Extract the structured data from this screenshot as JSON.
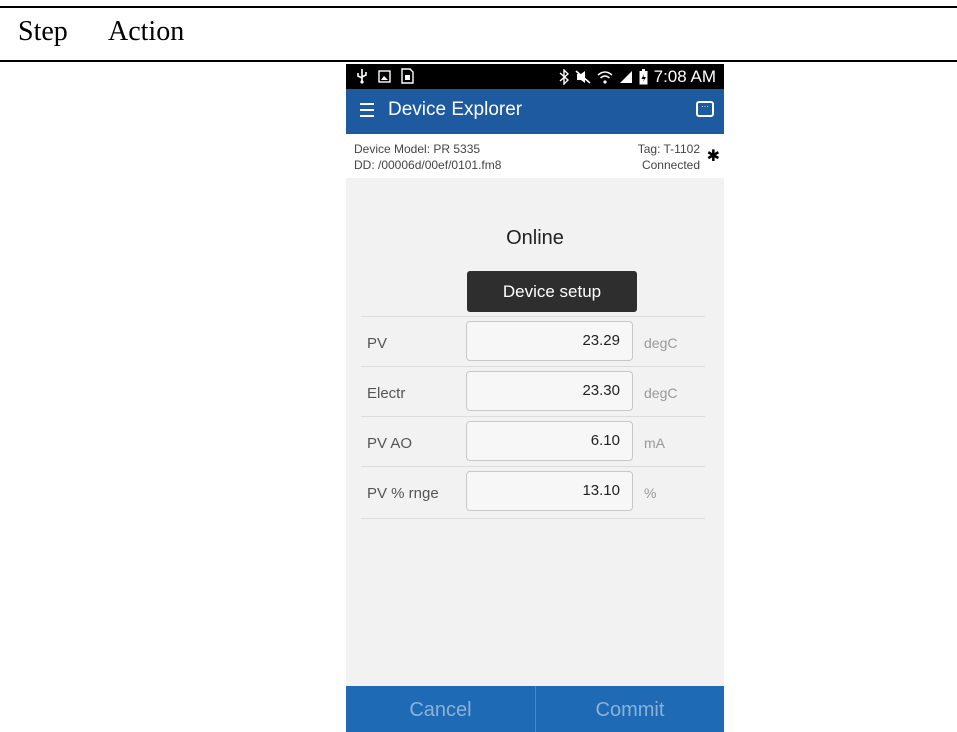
{
  "document": {
    "col_step": "Step",
    "col_action": "Action"
  },
  "statusbar": {
    "left_icons": [
      "usb-icon",
      "image-icon",
      "sim-icon"
    ],
    "right_icons": [
      "bluetooth-icon",
      "mute-icon",
      "wifi-icon",
      "signal-icon",
      "battery-icon"
    ],
    "time": "7:08 AM"
  },
  "appbar": {
    "title": "Device Explorer"
  },
  "device_info": {
    "model": "Device Model:  PR 5335",
    "dd": "DD:  /00006d/00ef/0101.fm8",
    "tag": "Tag:  T-1102",
    "status": "Connected"
  },
  "main": {
    "heading": "Online",
    "setup_button": "Device setup",
    "params": [
      {
        "label": "PV",
        "value": "23.29",
        "unit": "degC"
      },
      {
        "label": "Electr",
        "value": "23.30",
        "unit": "degC"
      },
      {
        "label": "PV AO",
        "value": "6.10",
        "unit": "mA"
      },
      {
        "label": "PV % rnge",
        "value": "13.10",
        "unit": "%"
      }
    ]
  },
  "footer": {
    "cancel": "Cancel",
    "commit": "Commit"
  },
  "colors": {
    "appbar": "#1e5aa0",
    "bottombar": "#1e6ab5",
    "button_dark": "#2e2e2e"
  }
}
